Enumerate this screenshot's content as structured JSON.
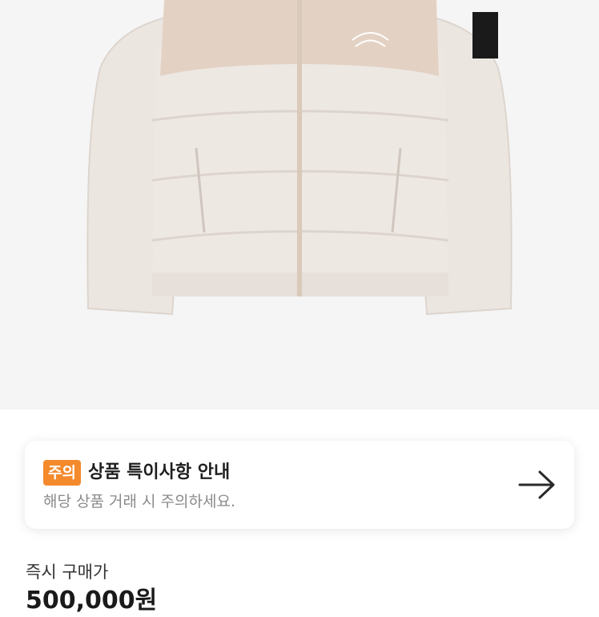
{
  "product_image": {
    "alt": "THE NORTH FACE"
  },
  "notice": {
    "badge": "주의",
    "title": "상품 특이사항 안내",
    "subtitle": "해당 상품 거래 시 주의하세요.",
    "badge_color": "#f58a2c"
  },
  "purchase": {
    "label": "즉시 구매가",
    "price": "500,000원"
  },
  "icons": {
    "arrow": "arrow-right-icon"
  }
}
